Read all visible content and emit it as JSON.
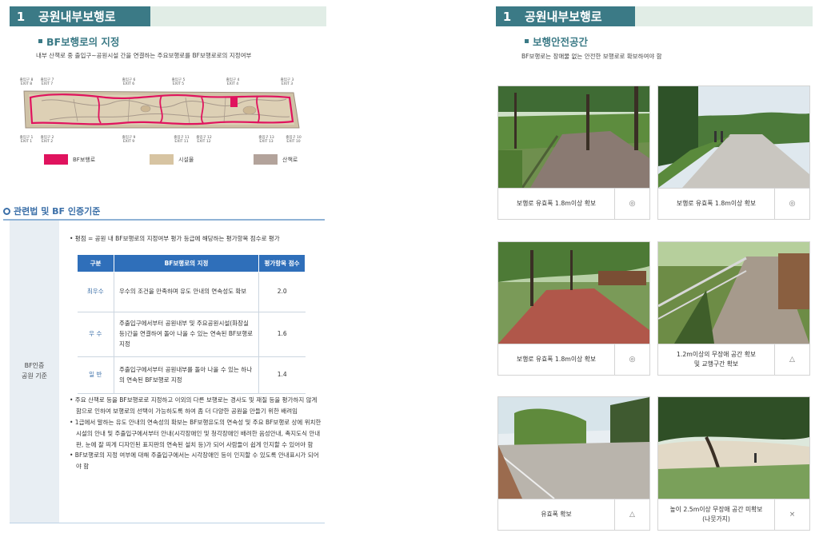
{
  "left": {
    "section_num": "1",
    "section_title": "공원내부보행로",
    "subhead": "BF보행로의 지정",
    "description": "내부 산책로 중 출입구~공원시설 간을 연결하는 주요보행로를 BF보행로로의 지정여부",
    "map_exits": [
      "출입구 8\nEXIT 8",
      "출입구 7\nEXIT 7",
      "출입구 6\nEXIT 6",
      "출입구 5\nEXIT 5",
      "출입구 4\nEXIT 4",
      "출입구 3\nEXIT 3",
      "출입구 1\nEXIT 1",
      "출입구 2\nEXIT 2",
      "출입구 9\nEXIT 9",
      "출입구 11\nEXIT 11",
      "출입구 12\nEXIT 12",
      "출입구 13\nEXIT 13",
      "출입구 10\nEXIT 10"
    ],
    "legend": [
      {
        "label": "BF보행로",
        "color": "#e0135e"
      },
      {
        "label": "시설물",
        "color": "#d7c4a2"
      },
      {
        "label": "산책로",
        "color": "#b3a39b"
      }
    ],
    "law_title": "관련법 및  BF 인증기준",
    "law_label_line1": "BF인증",
    "law_label_line2": "공원 기준",
    "law_intro": "• 평점 = 공원 내 BF보행로의 지정여부 평가 등급에 해당하는 평가항목 점수로 평가",
    "table_headers": [
      "구분",
      "BF보행로의 지정",
      "평가항목 점수"
    ],
    "table_rows": [
      {
        "grade": "최우수",
        "text": "우수의 조건을 만족하며 유도 안내의 연속성도 확보",
        "score": "2.0"
      },
      {
        "grade": "우 수",
        "text": "주출입구에서부터 공원내부 및 주요공원시설(화장실 등)간을 연결하여 돌아 나올 수 있는 연속된 BF보행로 지정",
        "score": "1.6"
      },
      {
        "grade": "일 반",
        "text": "주출입구에서부터 공원내부를 돌아 나올 수 있는 하나의 연속된 BF보행로 지정",
        "score": "1.4"
      }
    ],
    "notes": [
      "• 주요 산책로 등을 BF보행로로 지정하고 이외의 다른 보행로는 경사도 및 재질 등을 평가하지 않게 함으로 인하여 보행로의 선택이 가능하도록 하여 좀 더 다양한 공원을 만들기 위한 배려임",
      "• 1급에서 말하는 유도 안내의 연속성의 확보는 BF보행유도의 연속성 및 주요 BF보행로 상에 위치한 시설의 안내 및 주출입구에서부터 안내(시각장애인 및 청각장애인 배려한 음성안내, 촉지도식 안내판, 눈에 잘 띄게 디자인된 표지판의 연속된 설치 등)가 되어 사람들이 쉽게 인지할 수 있어야 함",
      "• BF보행로의 지정 여부에 대해 주출입구에서는 시각장애인 등이 인지할 수 있도록 안내표시가 되어야 함"
    ]
  },
  "right": {
    "section_num": "1",
    "section_title": "공원내부보행로",
    "subhead": "보행안전공간",
    "description": "BF보행로는 장애물 없는 안전한 보행로로 확보하여야 함",
    "cards": [
      {
        "caption": "보행로 유효폭 1.8m이상 확보",
        "mark": "◎"
      },
      {
        "caption": "보행로 유효폭 1.8m이상 확보",
        "mark": "◎"
      },
      {
        "caption": "보행로 유효폭 1.8m이상 확보",
        "mark": "◎"
      },
      {
        "caption": "1.2m이상의 무장애 공간 확보\n및 교행구간 확보",
        "mark": "△"
      },
      {
        "caption": "유효폭 확보",
        "mark": "△"
      },
      {
        "caption": "높이 2.5m이상 무장애 공간 미확보\n(나뭇가지)",
        "mark": "×"
      }
    ]
  }
}
